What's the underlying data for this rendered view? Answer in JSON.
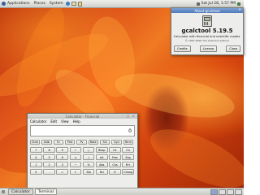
{
  "top_panel": {
    "menus": [
      "Applications",
      "Places",
      "System"
    ],
    "datetime": "Sat Jul 28, 1:57 PM"
  },
  "bottom_panel": {
    "tasks": [
      {
        "label": "Calculator",
        "active": true
      },
      {
        "label": "Terminal",
        "active": false
      }
    ]
  },
  "about_dialog": {
    "title": "About gcalctool",
    "close_glyph": "×",
    "app_name": "gcalctool 5.19.5",
    "description": "Calculator with financial and scientific modes.",
    "copyright": "© 1987-2006 The Gcalctool authors",
    "buttons": {
      "credits": "Credits",
      "license": "License",
      "close": "Close"
    }
  },
  "calculator": {
    "title": "Calculator - Financial",
    "window_controls": "– □ ×",
    "menus": [
      "Calculator",
      "Edit",
      "View",
      "Help"
    ],
    "display_value": "0",
    "function_keys": [
      "Ctrm",
      "Ddb",
      "Fv",
      "Pmt",
      "Pv",
      "Rate",
      "Sln",
      "Syd",
      "Term"
    ],
    "keypad": [
      [
        "7",
        "8",
        "9",
        "÷",
        "(",
        "Bksp",
        "Clr",
        "Clr"
      ],
      [
        "4",
        "5",
        "6",
        "×",
        ")",
        "Int",
        "Frac",
        "Exp"
      ],
      [
        "1",
        "2",
        "3",
        "−",
        "%",
        "Abs",
        "Chs",
        "M+"
      ],
      [
        "0",
        ".",
        "=",
        "+",
        "Sto",
        "Rcl",
        "x²",
        "Chang"
      ]
    ]
  }
}
